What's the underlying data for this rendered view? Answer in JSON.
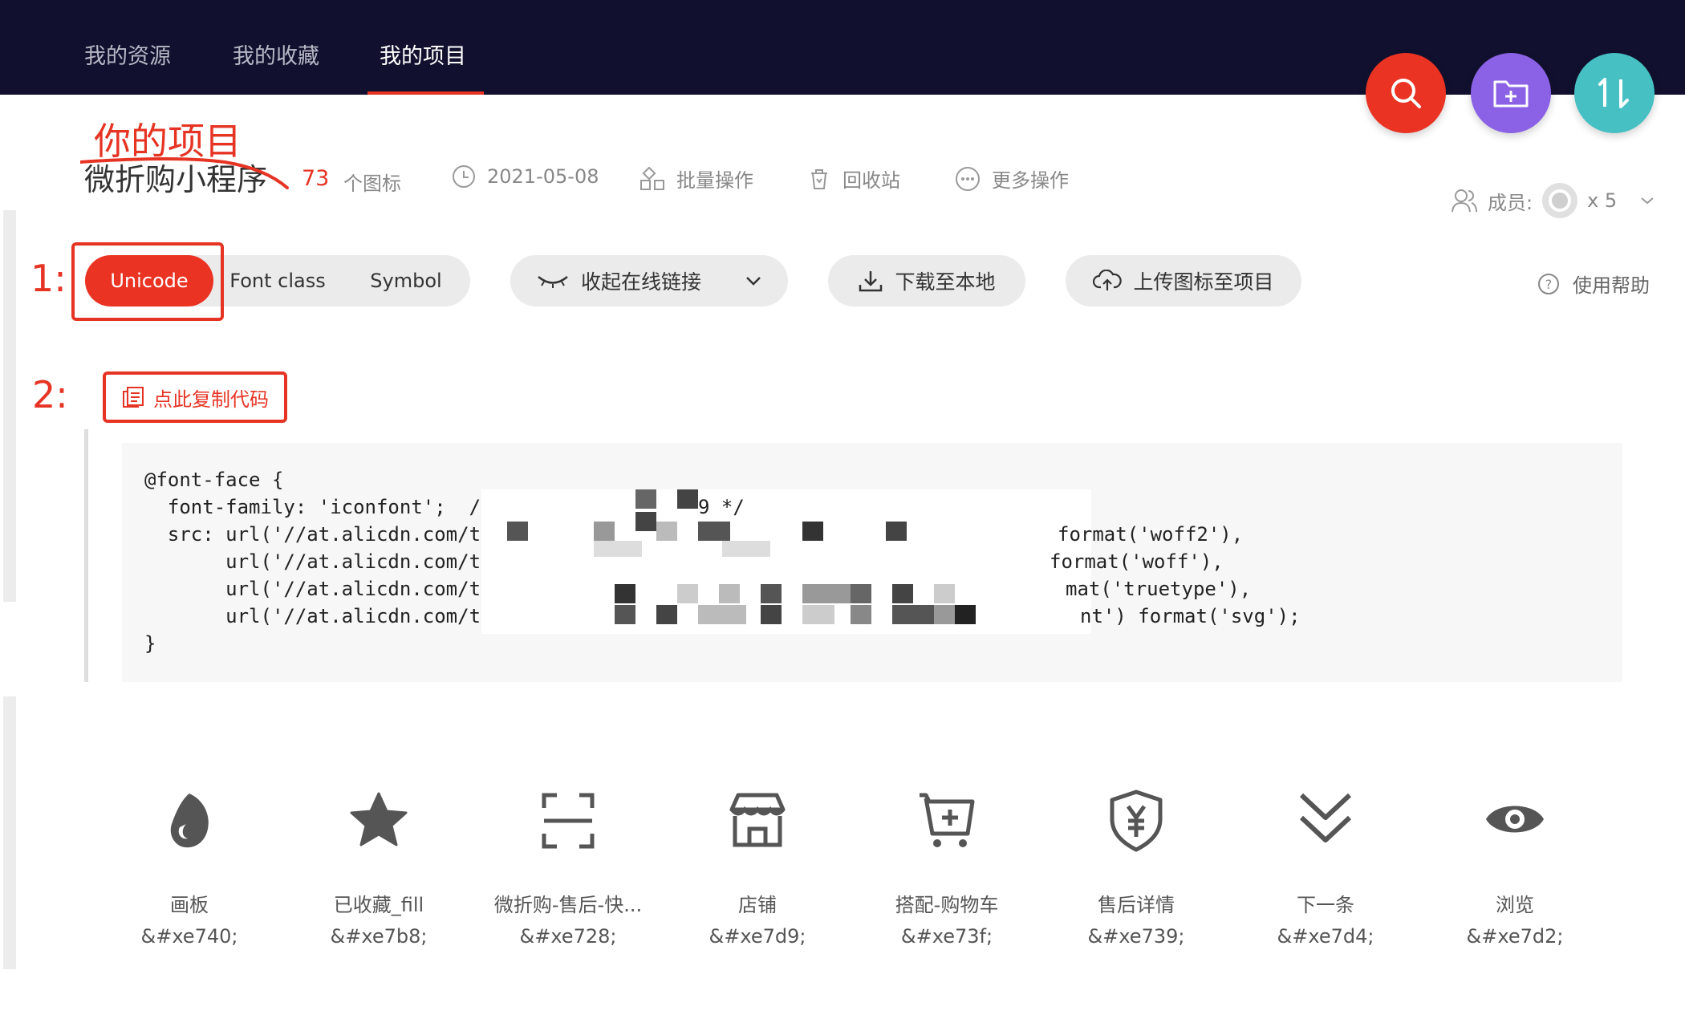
{
  "nav": {
    "tabs": [
      {
        "label": "我的资源"
      },
      {
        "label": "我的收藏"
      },
      {
        "label": "我的项目"
      }
    ],
    "active_tab": 2
  },
  "actions": {
    "search_icon": "search-icon",
    "new_folder_icon": "folder-plus-icon",
    "sort_icon": "sort-icon"
  },
  "project": {
    "annotation": "你的项目",
    "name": "微折购小程序",
    "icon_count": "73",
    "icon_count_label": "个图标",
    "date": "2021-05-08",
    "batch_label": "批量操作",
    "trash_label": "回收站",
    "more_label": "更多操作",
    "members_label": "成员:",
    "members_count": "x 5"
  },
  "toolbar": {
    "step1": "1:",
    "step2": "2:",
    "tabs": [
      "Unicode",
      "Font class",
      "Symbol"
    ],
    "active": "Unicode",
    "collapse_link": "收起在线链接",
    "download": "下载至本地",
    "upload": "上传图标至项目",
    "help": "使用帮助",
    "copy_code": "点此复制代码"
  },
  "code": {
    "lines": [
      "@font-face {",
      "  font-family: 'iconfont';  /* Project i",
      "  src: url('//at.alicdn.com/t/",
      "       url('//at.alicdn.com/t/",
      "       url('//at.alicdn.com/t/font_17",
      "       url('//at.alicdn.com/t/font_1",
      "}"
    ],
    "tails": [
      "9 */",
      "format('woff2'),",
      "format('woff'),",
      "mat('truetype'),",
      "nt') format('svg');"
    ]
  },
  "icons": [
    {
      "name": "画板",
      "code": "&#xe740;",
      "glyph": "drop-icon"
    },
    {
      "name": "已收藏_fill",
      "code": "&#xe7b8;",
      "glyph": "star-icon"
    },
    {
      "name": "微折购-售后-快...",
      "code": "&#xe728;",
      "glyph": "scan-icon"
    },
    {
      "name": "店铺",
      "code": "&#xe7d9;",
      "glyph": "shop-icon"
    },
    {
      "name": "搭配-购物车",
      "code": "&#xe73f;",
      "glyph": "cart-add-icon"
    },
    {
      "name": "售后详情",
      "code": "&#xe739;",
      "glyph": "shield-yen-icon"
    },
    {
      "name": "下一条",
      "code": "&#xe7d4;",
      "glyph": "double-chevron-down-icon"
    },
    {
      "name": "浏览",
      "code": "&#xe7d2;",
      "glyph": "eye-icon"
    }
  ],
  "colors": {
    "accent": "#e63424",
    "header_bg": "#11112f",
    "fab_folder": "#8b61e6",
    "fab_sort": "#46c0c3"
  }
}
